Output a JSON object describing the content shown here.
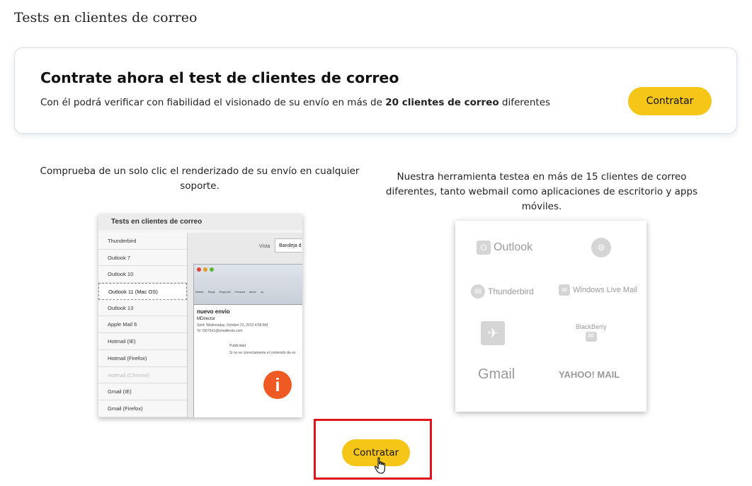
{
  "page": {
    "title": "Tests en clientes de correo"
  },
  "promo": {
    "heading": "Contrate ahora el test de clientes de correo",
    "text_before": "Con él podrá verificar con fiabilidad el visionado de su envío en más de ",
    "text_bold": "20 clientes de correo",
    "text_after": " diferentes",
    "button_label": "Contratar"
  },
  "columns": {
    "left_text": "Comprueba de un solo clic el renderizado de su envío en cualquier soporte.",
    "right_text": "Nuestra herramienta testea en más de 15 clientes de correo diferentes, tanto webmail como aplicaciones de escritorio y apps móviles."
  },
  "screenshot_left": {
    "title": "Tests en clientes de correo",
    "clients": [
      "Thunderbird",
      "Outlook 7",
      "Outlook 10",
      "Outlook 11 (Mac OS)",
      "Outlook 13",
      "Apple Mail 6",
      "Hotmail (IE)",
      "Hotmail (Firefox)",
      "Hotmail (Chrome)",
      "Gmail (IE)",
      "Gmail (Firefox)"
    ],
    "active_index": 3,
    "vista_label": "Vista",
    "vista_value": "Bandeja d",
    "mail_subject": "nuevo envio",
    "mail_from": "MDirector",
    "mail_sent": "Sent: Wednesday, October 23, 2013 4:58 AM",
    "mail_to": "To: f3675e1@emailtests.com",
    "mail_publicidad": "Publicidad",
    "mail_note": "Si no ve correctamente el contenido de es",
    "toolbar_items": [
      "Delete",
      "Reply",
      "Reply All",
      "Forward",
      "Move",
      "Ju"
    ]
  },
  "screenshot_right": {
    "clients": [
      "Outlook",
      "Thunderbird",
      "Windows Live Mail",
      "BlackBerry",
      "Gmail",
      "YAHOO! MAIL"
    ]
  },
  "bottom": {
    "button_label": "Contratar"
  },
  "colors": {
    "accent": "#f5c518",
    "highlight": "#e0141b"
  }
}
